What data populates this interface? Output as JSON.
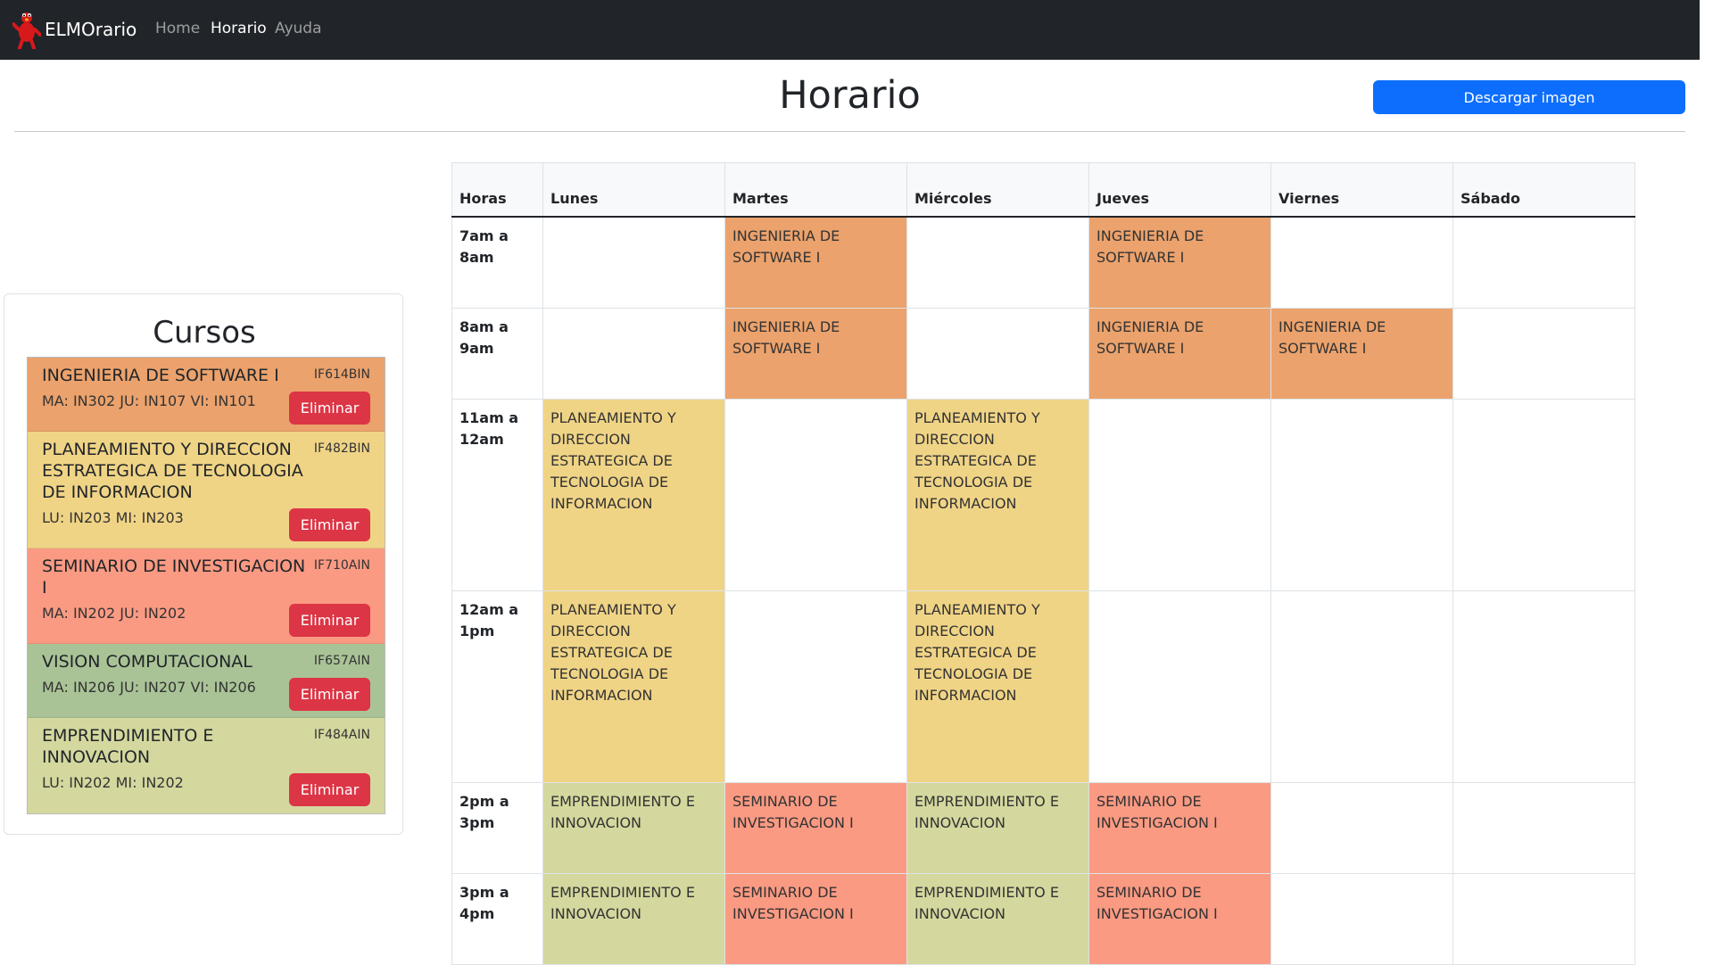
{
  "navbar": {
    "brand": "ELMOrario",
    "links": [
      "Home",
      "Horario",
      "Ayuda"
    ],
    "active": "Horario"
  },
  "page": {
    "title": "Horario",
    "download_label": "Descargar imagen"
  },
  "courses": {
    "title": "Cursos",
    "delete_label": "Eliminar",
    "items": [
      {
        "name": "INGENIERIA DE SOFTWARE I",
        "code": "IF614BIN",
        "rooms": "MA: IN302 JU: IN107 VI: IN101",
        "color": "#eba26c"
      },
      {
        "name": "PLANEAMIENTO Y DIRECCION ESTRATEGICA DE TECNOLOGIA DE INFORMACION",
        "code": "IF482BIN",
        "rooms": "LU: IN203 MI: IN203",
        "color": "#f0d486"
      },
      {
        "name": "SEMINARIO DE INVESTIGACION I",
        "code": "IF710AIN",
        "rooms": "MA: IN202 JU: IN202",
        "color": "#fa9a83"
      },
      {
        "name": "VISION COMPUTACIONAL",
        "code": "IF657AIN",
        "rooms": "MA: IN206 JU: IN207 VI: IN206",
        "color": "#a9c396"
      },
      {
        "name": "EMPRENDIMIENTO E INNOVACION",
        "code": "IF484AIN",
        "rooms": "LU: IN202 MI: IN202",
        "color": "#d4d89e"
      }
    ]
  },
  "schedule": {
    "headers": [
      "Horas",
      "Lunes",
      "Martes",
      "Miércoles",
      "Jueves",
      "Viernes",
      "Sábado"
    ],
    "rows": [
      {
        "hour": "7am a 8am",
        "cells": [
          "",
          "INGENIERIA DE SOFTWARE I",
          "",
          "INGENIERIA DE SOFTWARE I",
          "",
          ""
        ]
      },
      {
        "hour": "8am a 9am",
        "cells": [
          "",
          "INGENIERIA DE SOFTWARE I",
          "",
          "INGENIERIA DE SOFTWARE I",
          "INGENIERIA DE SOFTWARE I",
          ""
        ]
      },
      {
        "hour": "11am a 12am",
        "cells": [
          "PLANEAMIENTO Y DIRECCION ESTRATEGICA DE TECNOLOGIA DE INFORMACION",
          "",
          "PLANEAMIENTO Y DIRECCION ESTRATEGICA DE TECNOLOGIA DE INFORMACION",
          "",
          "",
          ""
        ]
      },
      {
        "hour": "12am a 1pm",
        "cells": [
          "PLANEAMIENTO Y DIRECCION ESTRATEGICA DE TECNOLOGIA DE INFORMACION",
          "",
          "PLANEAMIENTO Y DIRECCION ESTRATEGICA DE TECNOLOGIA DE INFORMACION",
          "",
          "",
          ""
        ]
      },
      {
        "hour": "2pm a 3pm",
        "cells": [
          "EMPRENDIMIENTO E INNOVACION",
          "SEMINARIO DE INVESTIGACION I",
          "EMPRENDIMIENTO E INNOVACION",
          "SEMINARIO DE INVESTIGACION I",
          "",
          ""
        ]
      },
      {
        "hour": "3pm a 4pm",
        "cells": [
          "EMPRENDIMIENTO E INNOVACION",
          "SEMINARIO DE INVESTIGACION I",
          "EMPRENDIMIENTO E INNOVACION",
          "SEMINARIO DE INVESTIGACION I",
          "",
          ""
        ]
      }
    ]
  },
  "colors": {
    "navbar_bg": "#212529",
    "primary": "#0d6efd",
    "danger": "#dc3545"
  }
}
